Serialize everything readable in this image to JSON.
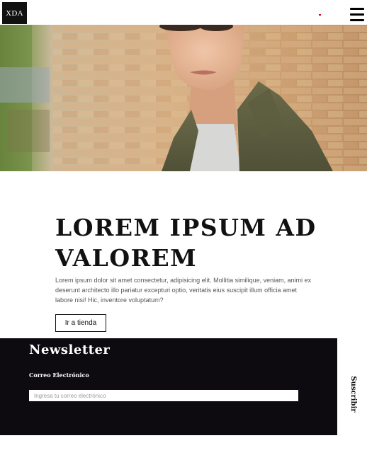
{
  "header": {
    "logo_text": "XDA"
  },
  "hero": {
    "image": "portrait-of-young-man-in-sunglasses-and-olive-jacket"
  },
  "promo": {
    "title": "LOREM IPSUM AD VALOREM",
    "text": "Lorem ipsum dolor sit amet consectetur, adipisicing elit. Mollitia similique, veniam, animi ex deserunt architecto illo pariatur excepturi optio, veritatis eius suscipit illum officia amet labore nisi! Hic, inventore voluptatum?",
    "button_label": "Ir a tienda"
  },
  "newsletter": {
    "title": "Newsletter",
    "email_label": "Correo Electrónico",
    "email_placeholder": "Ingresa tu correo electrónico",
    "email_value": "",
    "subscribe_label": "Suscribir"
  },
  "colors": {
    "logo_bg": "#111111",
    "newsletter_bg": "#0d0b10",
    "accent_dot": "#d0021b"
  },
  "icons": {
    "menu": "hamburger-menu-icon"
  }
}
